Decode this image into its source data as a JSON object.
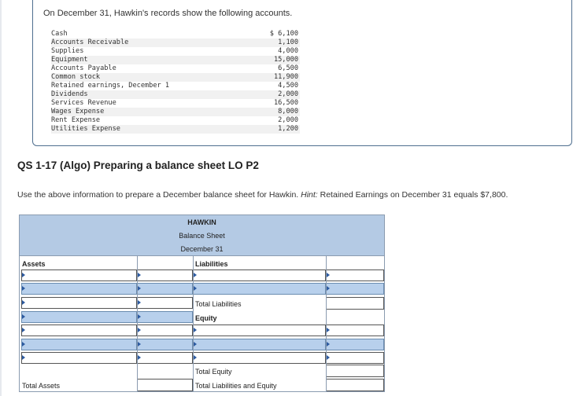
{
  "intro": "On December 31, Hawkin's records show the following accounts.",
  "accounts": [
    {
      "name": "Cash",
      "amount": "$ 6,100"
    },
    {
      "name": "Accounts Receivable",
      "amount": "1,100"
    },
    {
      "name": "Supplies",
      "amount": "4,000"
    },
    {
      "name": "Equipment",
      "amount": "15,000"
    },
    {
      "name": "Accounts Payable",
      "amount": "6,500"
    },
    {
      "name": "Common stock",
      "amount": "11,900"
    },
    {
      "name": "Retained earnings, December 1",
      "amount": "4,500"
    },
    {
      "name": "Dividends",
      "amount": "2,000"
    },
    {
      "name": "Services Revenue",
      "amount": "16,500"
    },
    {
      "name": "Wages Expense",
      "amount": "8,000"
    },
    {
      "name": "Rent Expense",
      "amount": "2,000"
    },
    {
      "name": "Utilities Expense",
      "amount": "1,200"
    }
  ],
  "question_title": "QS 1-17 (Algo) Preparing a balance sheet LO P2",
  "instruction": {
    "text": "Use the above information to prepare a December balance sheet for Hawkin. ",
    "hint_label": "Hint:",
    "hint_text": " Retained Earnings on December 31 equals $7,800."
  },
  "balance_sheet": {
    "company": "HAWKIN",
    "statement": "Balance Sheet",
    "date": "December 31",
    "assets_label": "Assets",
    "liabilities_label": "Liabilities",
    "total_liabilities_label": "Total Liabilities",
    "equity_label": "Equity",
    "total_equity_label": "Total Equity",
    "total_assets_label": "Total Assets",
    "total_liab_equity_label": "Total Liabilities and Equity"
  }
}
